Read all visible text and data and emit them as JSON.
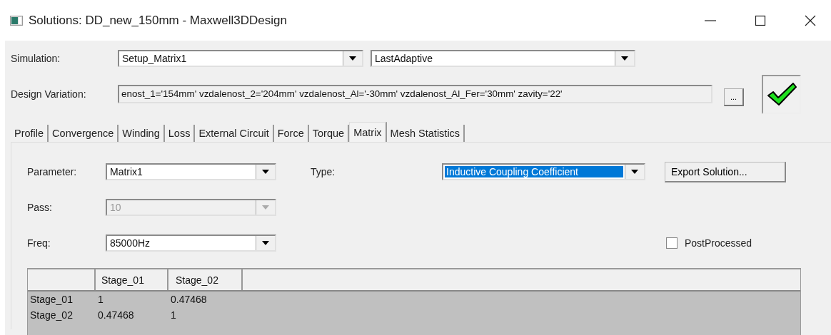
{
  "window": {
    "title": "Solutions: DD_new_150mm - Maxwell3DDesign"
  },
  "simulation": {
    "label": "Simulation:",
    "setup": "Setup_Matrix1",
    "solution": "LastAdaptive"
  },
  "design_variation": {
    "label": "Design Variation:",
    "value": "enost_1='154mm' vzdalenost_2='204mm' vzdalenost_Al='-30mm' vzdalenost_Al_Fer='30mm' zavity='22'",
    "browse_button": "...",
    "status_ok": true
  },
  "tabs": [
    {
      "label": "Profile",
      "selected": false
    },
    {
      "label": "Convergence",
      "selected": false
    },
    {
      "label": "Winding",
      "selected": false
    },
    {
      "label": "Loss",
      "selected": false
    },
    {
      "label": "External Circuit",
      "selected": false
    },
    {
      "label": "Force",
      "selected": false
    },
    {
      "label": "Torque",
      "selected": false
    },
    {
      "label": "Matrix",
      "selected": true
    },
    {
      "label": "Mesh Statistics",
      "selected": false
    }
  ],
  "parameter": {
    "label": "Parameter:",
    "value": "Matrix1"
  },
  "type": {
    "label": "Type:",
    "value": "Inductive Coupling Coefficient",
    "highlighted": true
  },
  "export_button": "Export Solution...",
  "pass": {
    "label": "Pass:",
    "value": "10",
    "disabled": true
  },
  "freq": {
    "label": "Freq:",
    "value": "85000Hz"
  },
  "post_processed": {
    "label": "PostProcessed",
    "checked": false
  },
  "table": {
    "columns": [
      "Stage_01",
      "Stage_02"
    ],
    "rows": [
      {
        "header": "Stage_01",
        "cells": [
          "1",
          "0.47468"
        ]
      },
      {
        "header": "Stage_02",
        "cells": [
          "0.47468",
          "1"
        ]
      }
    ]
  }
}
